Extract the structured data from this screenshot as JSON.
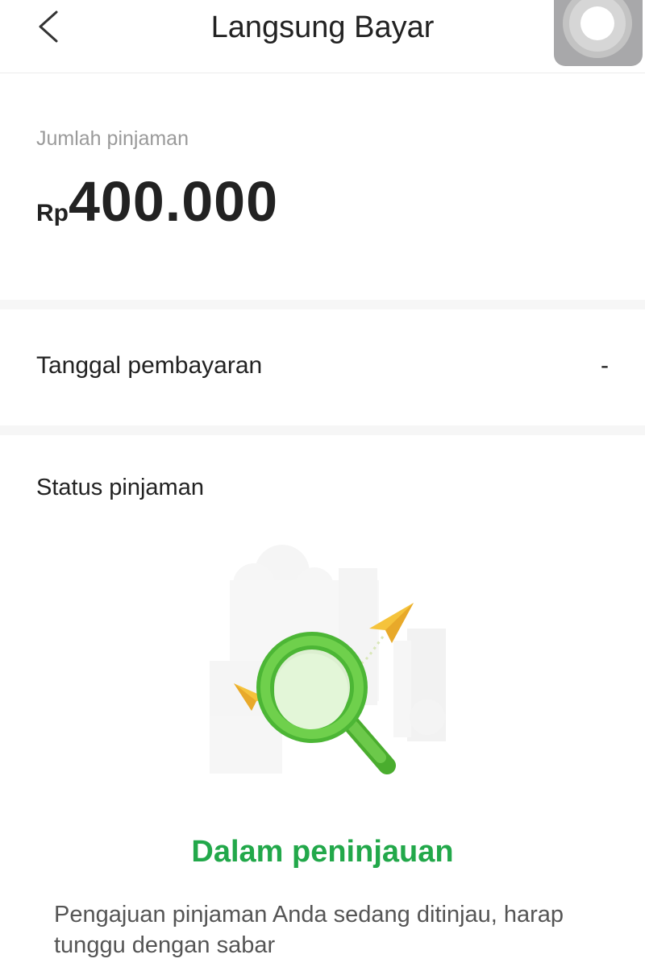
{
  "header": {
    "title": "Langsung Bayar",
    "back_icon": "chevron-left-icon",
    "float_icon": "assistive-touch-icon"
  },
  "loan": {
    "label": "Jumlah pinjaman",
    "currency": "Rp",
    "amount": "400.000"
  },
  "payment": {
    "label": "Tanggal pembayaran",
    "value": "-"
  },
  "status": {
    "label": "Status pinjaman",
    "illustration_icon": "magnifying-glass-icon",
    "title": "Dalam peninjauan",
    "description": "Pengajuan pinjaman Anda sedang ditinjau, harap tunggu dengan sabar"
  },
  "colors": {
    "accent_green": "#22a84a",
    "magnifier_green": "#5cc641",
    "plane_yellow": "#f5c33b"
  }
}
